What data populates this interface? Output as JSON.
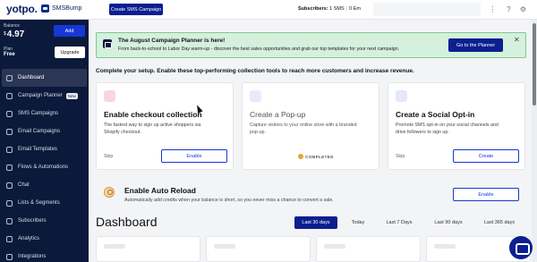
{
  "topbar": {
    "logo": "yotpo.",
    "app_name": "SMSBump",
    "create_button": "Create SMS Campaign",
    "subscribers_label": "Subscribers:",
    "subscribers_sms": "1 SMS",
    "subscribers_email": "0 Em"
  },
  "sidebar": {
    "balance_label": "Balance",
    "balance_currency": "$",
    "balance_amount": "4.97",
    "add_button": "Add",
    "plan_label": "Plan",
    "plan_value": "Free",
    "upgrade_button": "Upgrade",
    "items": [
      {
        "label": "Dashboard"
      },
      {
        "label": "Campaign Planner",
        "badge": "New"
      },
      {
        "label": "SMS Campaigns"
      },
      {
        "label": "Email Campaigns"
      },
      {
        "label": "Email Templates"
      },
      {
        "label": "Flows & Automations"
      },
      {
        "label": "Chat"
      },
      {
        "label": "Lists & Segments"
      },
      {
        "label": "Subscribers"
      },
      {
        "label": "Analytics"
      },
      {
        "label": "Integrations"
      }
    ]
  },
  "banner": {
    "title": "The August Campaign Planner is here!",
    "text": "From back-to-school to Labor Day warm-up - discover the best sales opportunities and grab our top templates for your next campaign.",
    "button": "Go to the Planner",
    "close": "✕"
  },
  "setup": {
    "heading": "Complete your setup. Enable these top-performing collection tools to reach more customers and increase revenue.",
    "cards": [
      {
        "title": "Enable checkout collection",
        "desc": "The fastest way to sign up active shoppers via Shopify checkout.",
        "skip": "Skip",
        "button": "Enable"
      },
      {
        "title": "Create a Pop-up",
        "desc": "Capture visitors to your online store with a branded pop-up.",
        "status": "COMPLETED"
      },
      {
        "title": "Create a Social Opt-in",
        "desc": "Promote SMS opt-in on your social channels and drive followers to sign up.",
        "skip": "Skip",
        "button": "Create"
      }
    ]
  },
  "auto_reload": {
    "title": "Enable Auto Reload",
    "desc": "Automatically add credits when your balance is short, so you never miss a chance to convert a sale.",
    "button": "Enable"
  },
  "dashboard": {
    "title": "Dashboard",
    "ranges": [
      "Last 30 days",
      "Today",
      "Last 7 Days",
      "Last 90 days",
      "Last 365 days"
    ],
    "active_range": "Last 30 days"
  },
  "colors": {
    "sidebar_bg": "#0b1a3b",
    "primary": "#0b1f8f",
    "banner_bg": "#d5f0dc"
  }
}
